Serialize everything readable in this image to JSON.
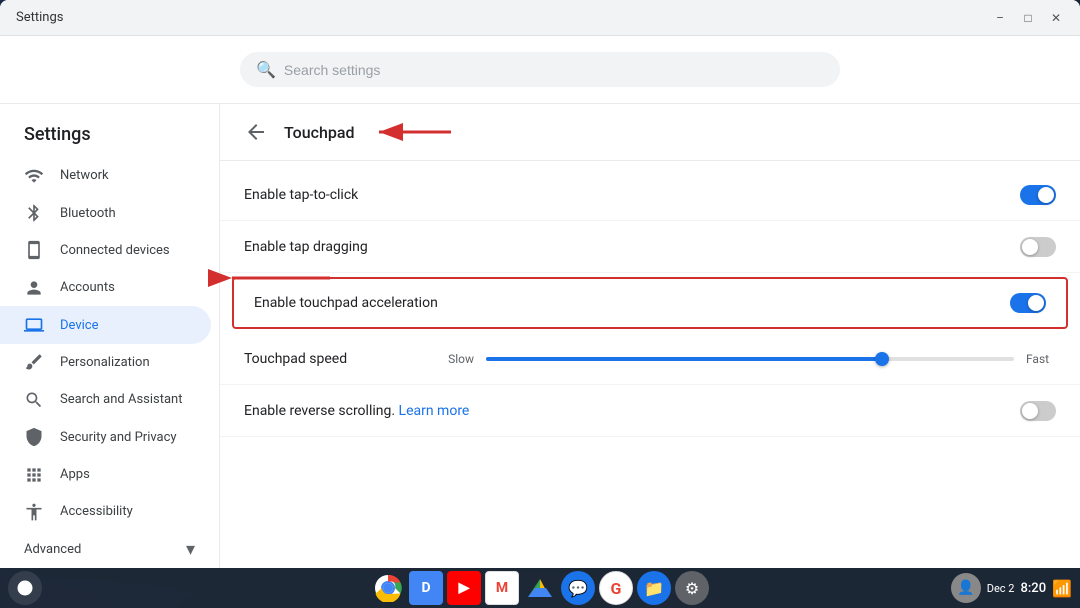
{
  "window": {
    "title": "Settings"
  },
  "search": {
    "placeholder": "Search settings"
  },
  "sidebar": {
    "title": "Settings",
    "items": [
      {
        "id": "network",
        "label": "Network",
        "icon": "wifi"
      },
      {
        "id": "bluetooth",
        "label": "Bluetooth",
        "icon": "bluetooth"
      },
      {
        "id": "connected-devices",
        "label": "Connected devices",
        "icon": "devices"
      },
      {
        "id": "accounts",
        "label": "Accounts",
        "icon": "person"
      },
      {
        "id": "device",
        "label": "Device",
        "icon": "laptop",
        "active": true
      },
      {
        "id": "personalization",
        "label": "Personalization",
        "icon": "brush"
      },
      {
        "id": "search-assistant",
        "label": "Search and Assistant",
        "icon": "search"
      },
      {
        "id": "security-privacy",
        "label": "Security and Privacy",
        "icon": "shield"
      },
      {
        "id": "apps",
        "label": "Apps",
        "icon": "apps"
      },
      {
        "id": "accessibility",
        "label": "Accessibility",
        "icon": "accessibility"
      }
    ],
    "advanced": {
      "label": "Advanced"
    }
  },
  "panel": {
    "title": "Touchpad",
    "settings": [
      {
        "id": "tap-to-click",
        "label": "Enable tap-to-click",
        "enabled": true,
        "highlighted": false
      },
      {
        "id": "tap-dragging",
        "label": "Enable tap dragging",
        "enabled": false,
        "highlighted": false
      },
      {
        "id": "touchpad-acceleration",
        "label": "Enable touchpad acceleration",
        "enabled": true,
        "highlighted": true
      }
    ],
    "speed": {
      "label": "Touchpad speed",
      "slow": "Slow",
      "fast": "Fast",
      "value": 75
    },
    "reverse_scrolling": {
      "label": "Enable reverse scrolling.",
      "link_text": "Learn more",
      "enabled": false
    }
  },
  "taskbar": {
    "time": "8:20",
    "date": "Dec 2",
    "icons": [
      {
        "id": "chrome",
        "color": "#4285f4"
      },
      {
        "id": "docs",
        "color": "#4285f4"
      },
      {
        "id": "youtube",
        "color": "#ff0000"
      },
      {
        "id": "gmail",
        "color": "#ea4335"
      },
      {
        "id": "drive",
        "color": "#34a853"
      },
      {
        "id": "messages",
        "color": "#1a73e8"
      },
      {
        "id": "google",
        "color": "#ea4335"
      },
      {
        "id": "files",
        "color": "#1a73e8"
      },
      {
        "id": "settings-app",
        "color": "#5f6368"
      }
    ]
  }
}
